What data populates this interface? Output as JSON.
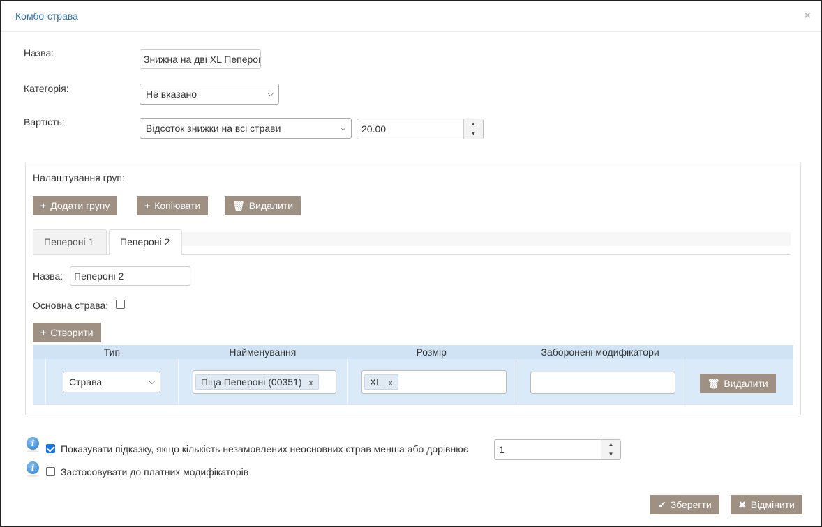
{
  "dialog": {
    "title": "Комбо-страва",
    "close": "×"
  },
  "form": {
    "name_label": "Назва:",
    "name_value": "Знижна на дві XL Пепероні",
    "category_label": "Категорія:",
    "category_value": "Не вказано",
    "cost_label": "Вартість:",
    "cost_type_value": "Відсоток знижки на всі страви",
    "cost_amount": "20.00"
  },
  "groups": {
    "heading": "Налаштування груп:",
    "add_label": "Додати групу",
    "copy_label": "Копіювати",
    "delete_label": "Видалити",
    "tabs": [
      {
        "label": "Пепероні 1",
        "active": false
      },
      {
        "label": "Пепероні 2",
        "active": true
      }
    ],
    "group_name_label": "Назва:",
    "group_name_value": "Пепероні 2",
    "main_dish_label": "Основна страва:",
    "main_dish_checked": false,
    "create_label": "Створити",
    "table": {
      "headers": [
        "Тип",
        "Найменування",
        "Розмір",
        "Заборонені модифікатори"
      ],
      "rows": [
        {
          "type": "Страва",
          "name_tag": "Піца Пепероні (00351)",
          "size_tag": "XL",
          "forbidden": "",
          "delete_label": "Видалити"
        }
      ]
    }
  },
  "options": {
    "hint_label": "Показувати підказку, якщо кількість незамовлених неосновних страв менша або дорівнює",
    "hint_checked": true,
    "hint_value": "1",
    "paid_mod_label": "Застосовувати до платних модифікаторів",
    "paid_mod_checked": false
  },
  "footer": {
    "save_label": "Зберегти",
    "cancel_label": "Відмінити"
  },
  "colors": {
    "title": "#2f6fa7",
    "button_bg": "#9e9184",
    "table_header": "#cfe3f5",
    "table_row": "#dbeaf8",
    "checkbox_checked": "#1b73e8"
  }
}
